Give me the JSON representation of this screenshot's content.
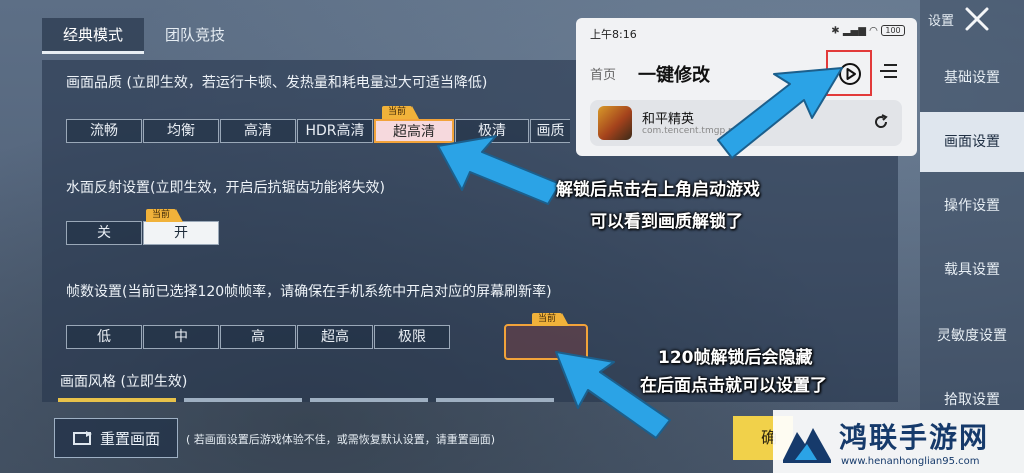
{
  "tabs": {
    "classic": "经典模式",
    "team": "团队竞技"
  },
  "quality": {
    "title": "画面品质 (立即生效，若运行卡顿、发热量和耗电量过大可适当降低)",
    "options": [
      "流畅",
      "均衡",
      "高清",
      "HDR高清",
      "超高清",
      "极清",
      "画质对"
    ],
    "current_badge": "当前"
  },
  "water": {
    "title": "水面反射设置(立即生效，开启后抗锯齿功能将失效)",
    "options": [
      "关",
      "开"
    ],
    "current_badge": "当前"
  },
  "fps": {
    "title": "帧数设置(当前已选择120帧帧率，请确保在手机系统中开启对应的屏幕刷新率)",
    "options": [
      "低",
      "中",
      "高",
      "超高",
      "极限"
    ],
    "current_badge": "当前"
  },
  "style": {
    "title": "画面风格 (立即生效)"
  },
  "sidebar": {
    "title": "设置",
    "items": [
      "基础设置",
      "画面设置",
      "操作设置",
      "载具设置",
      "灵敏度设置",
      "拾取设置"
    ]
  },
  "bottom": {
    "reset_label": "重置画面",
    "note": "( 若画面设置后游戏体验不佳，或需恢复默认设置，请重置画面)",
    "confirm_label": "确"
  },
  "phone": {
    "time": "上午8:16",
    "battery": "100",
    "home": "首页",
    "title": "一键修改",
    "app_name": "和平精英",
    "app_package": "com.tencent.tmgp.pub"
  },
  "annotations": {
    "line1": "解锁后点击右上角启动游戏",
    "line2": "可以看到画质解锁了",
    "line3": "120帧解锁后会隐藏",
    "line4": "在后面点击就可以设置了"
  },
  "watermark": {
    "name": "鸿联手游网",
    "url": "www.henanhonglian95.com"
  },
  "colors": {
    "current_badge": "#f1b23a",
    "arrow": "#2ba3e6",
    "highlight_border": "#f2a33a",
    "play_box": "#e23a3a"
  },
  "icons": [
    "close-icon",
    "play-icon",
    "menu-icon",
    "refresh-icon",
    "reset-icon",
    "bluetooth-icon",
    "signal-icon",
    "wifi-icon",
    "battery-icon"
  ]
}
